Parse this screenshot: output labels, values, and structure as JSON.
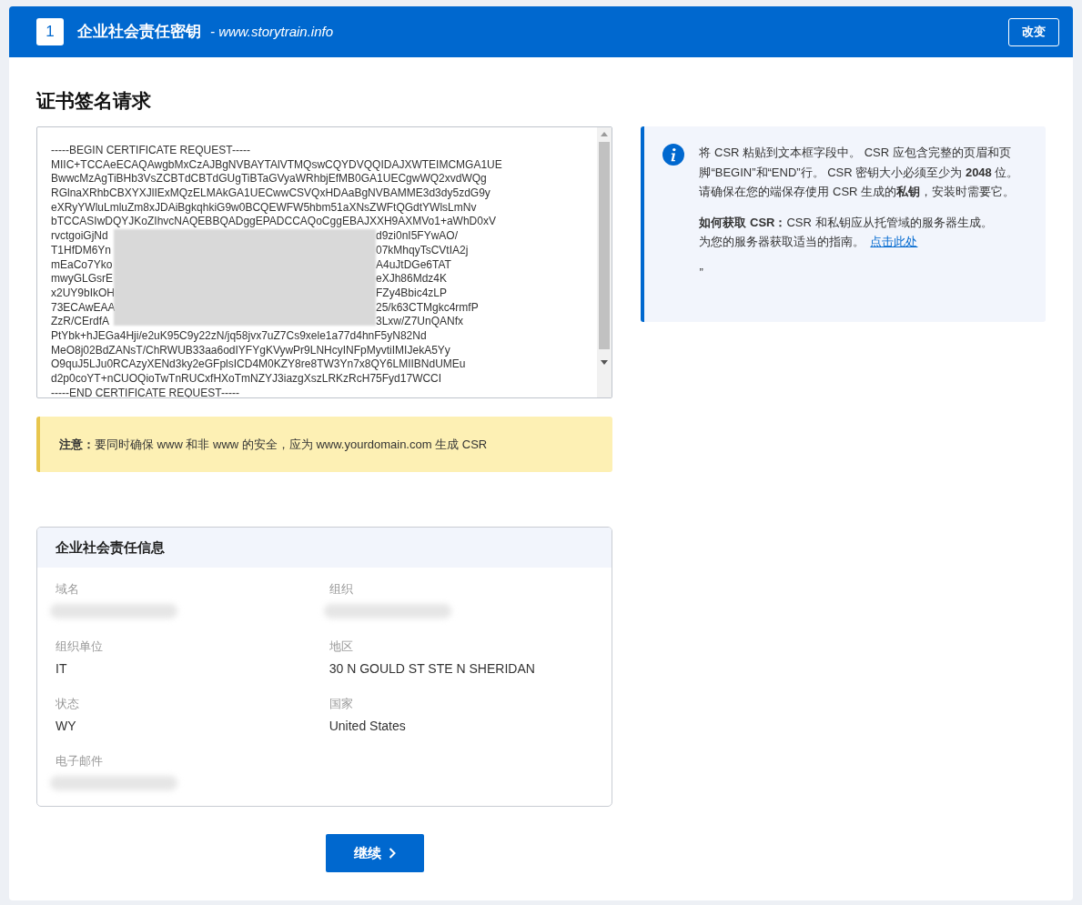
{
  "header": {
    "step": "1",
    "title": "企业社会责任密钥",
    "domain": "- www.storytrain.info",
    "change_button": "改变"
  },
  "section_title": "证书签名请求",
  "csr_lines": [
    {
      "kind": "plain",
      "text": "-----BEGIN CERTIFICATE REQUEST-----"
    },
    {
      "kind": "plain",
      "text": "MIIC+TCCAeECAQAwgbMxCzAJBgNVBAYTAlVTMQswCQYDVQQIDAJXWTEIMCMGA1UE"
    },
    {
      "kind": "plain",
      "text": "BwwcMzAgTiBHb3VsZCBTdCBTdGUgTiBTaGVyaWRhbjEfMB0GA1UECgwWQ2xvdWQg"
    },
    {
      "kind": "plain",
      "text": "RGlnaXRhbCBXYXJlIExMQzELMAkGA1UECwwCSVQxHDAaBgNVBAMME3d3dy5zdG9y"
    },
    {
      "kind": "plain",
      "text": "eXRyYWluLmluZm8xJDAiBgkqhkiG9w0BCQEWFW5hbm51aXNsZWFtQGdtYWlsLmNv"
    },
    {
      "kind": "plain",
      "text": "bTCCASIwDQYJKoZIhvcNAQEBBQADggEPADCCAQoCggEBAJXXH9AXMVo1+aWhD0xV"
    },
    {
      "kind": "redacted",
      "start": "rvctgoiGjNd",
      "end": "d9zi0nI5FYwAO/"
    },
    {
      "kind": "redacted",
      "start": "T1HfDM6Yn",
      "end": "07kMhqyTsCVtIA2j"
    },
    {
      "kind": "redacted",
      "start": "mEaCo7Yko",
      "end": "A4uJtDGe6TAT"
    },
    {
      "kind": "redacted",
      "start": "mwyGLGsrE",
      "end": "eXJh86Mdz4K"
    },
    {
      "kind": "redacted",
      "start": "x2UY9bIkOH",
      "end": "FZy4Bbic4zLP"
    },
    {
      "kind": "redacted",
      "start": "73ECAwEAA",
      "end": "25/k63CTMgkc4rmfP"
    },
    {
      "kind": "redacted",
      "start": "ZzR/CErdfA",
      "end": "3Lxw/Z7UnQANfx"
    },
    {
      "kind": "plain",
      "text": "PtYbk+hJEGa4Hji/e2uK95C9y22zN/jq58jvx7uZ7Cs9xele1a77d4hnF5yN82Nd"
    },
    {
      "kind": "plain",
      "text": "MeO8j02BdZANsT/ChRWUB33aa6odIYFYgKVywPr9LNHcyINFpMyvtiIMIJekA5Yy"
    },
    {
      "kind": "plain",
      "text": "O9quJ5LJu0RCAzyXENd3ky2eGFplsICD4M0KZY8re8TW3Yn7x8QY6LMIIBNdUMEu"
    },
    {
      "kind": "plain",
      "text": "d2p0coYT+nCUOQioTwTnRUCxfHXoTmNZYJ3iazgXszLRKzRcH75Fyd17WCCI"
    },
    {
      "kind": "plain",
      "text": "-----END CERTIFICATE REQUEST-----"
    }
  ],
  "notice": "**注意：**要同时确保 www 和非 www 的安全，应为 www.yourdomain.com 生成 CSR",
  "info": {
    "paragraph": "将 CSR 粘贴到文本框字段中。 CSR 应包含完整的页眉和页脚“BEGIN”和“END”行。 CSR 密钥大小必须至少为 **2048** 位。请确保在您的端保存使用 CSR 生成的**私钥**，安装时需要它。",
    "howto": "**如何获取 CSR：**CSR 和私钥应从托管域的服务器生成。",
    "guide": "为您的服务器获取适当的指南。",
    "link": "点击此处",
    "trailing": "”"
  },
  "details": {
    "title": "企业社会责任信息",
    "fields": [
      {
        "label": "域名",
        "redacted": true
      },
      {
        "label": "组织",
        "redacted": true
      },
      {
        "label": "组织单位",
        "value": "IT",
        "redacted": false
      },
      {
        "label": "地区",
        "value": "30 N GOULD ST STE N SHERIDAN",
        "redacted": false
      },
      {
        "label": "状态",
        "value": "WY",
        "redacted": false
      },
      {
        "label": "国家",
        "value": "United States",
        "redacted": false
      },
      {
        "label": "电子邮件",
        "redacted": true
      }
    ]
  },
  "continue_button": "继续"
}
